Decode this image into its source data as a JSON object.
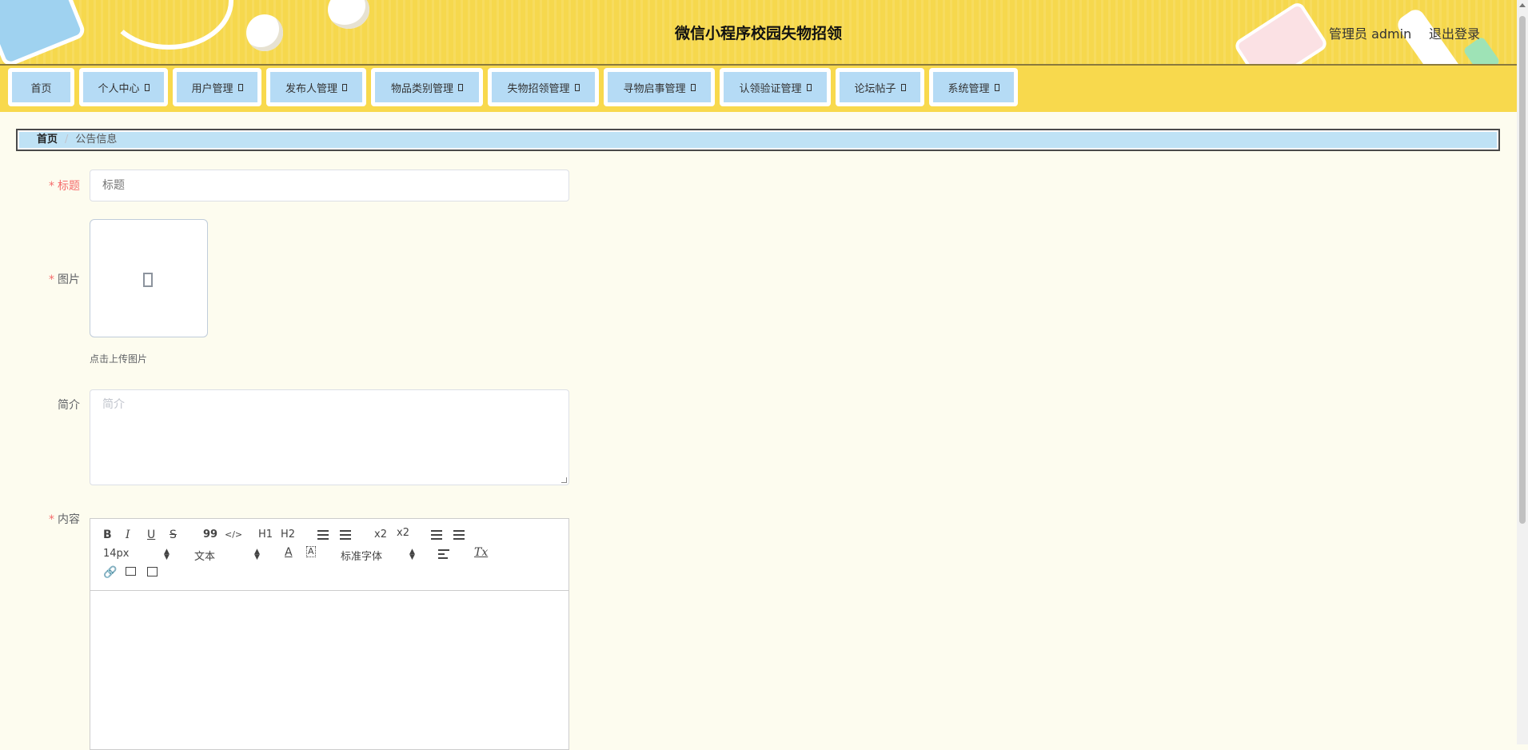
{
  "header": {
    "title": "微信小程序校园失物招领",
    "user_label": "管理员 admin",
    "logout_label": "退出登录"
  },
  "nav": {
    "items": [
      {
        "label": "首页",
        "has_arrow": false
      },
      {
        "label": "个人中心",
        "has_arrow": true
      },
      {
        "label": "用户管理",
        "has_arrow": true
      },
      {
        "label": "发布人管理",
        "has_arrow": true
      },
      {
        "label": "物品类别管理",
        "has_arrow": true
      },
      {
        "label": "失物招领管理",
        "has_arrow": true
      },
      {
        "label": "寻物启事管理",
        "has_arrow": true
      },
      {
        "label": "认领验证管理",
        "has_arrow": true
      },
      {
        "label": "论坛帖子",
        "has_arrow": true
      },
      {
        "label": "系统管理",
        "has_arrow": true
      }
    ]
  },
  "breadcrumb": {
    "home": "首页",
    "separator": "/",
    "current": "公告信息"
  },
  "form": {
    "title_label": "标题",
    "title_placeholder": "标题",
    "image_label": "图片",
    "image_tip": "点击上传图片",
    "intro_label": "简介",
    "intro_placeholder": "简介",
    "content_label": "内容",
    "required_mark": "*"
  },
  "editor": {
    "bold": "B",
    "italic": "I",
    "underline": "U",
    "strike": "S",
    "blockquote": "99",
    "code": "</>",
    "h1": "H1",
    "h2": "H2",
    "subscript": "x2",
    "superscript": "x2",
    "size_value": "14px",
    "header_value": "文本",
    "font_value": "标准字体",
    "clear_format": "Tx"
  },
  "colors": {
    "header_bg": "#f6d84d",
    "nav_item_bg": "#b5dbf5",
    "breadcrumb_bg": "#bfe2f5",
    "page_bg": "#fdfcef",
    "required": "#f56c6c"
  }
}
